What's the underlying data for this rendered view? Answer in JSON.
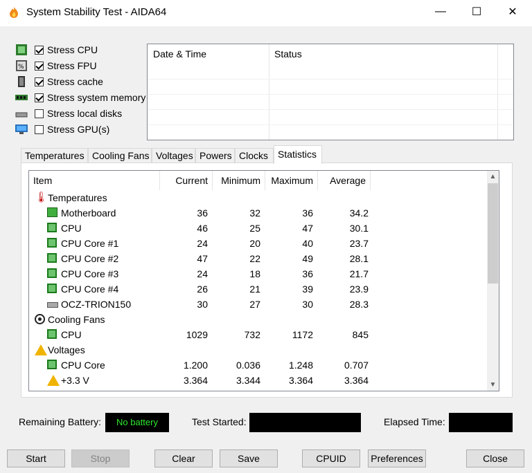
{
  "window": {
    "title": "System Stability Test - AIDA64",
    "minimize": "—",
    "maximize": "☐",
    "close": "✕"
  },
  "stress": [
    {
      "label": "Stress CPU",
      "checked": true,
      "icon": "cpu-icon"
    },
    {
      "label": "Stress FPU",
      "checked": true,
      "icon": "fpu-icon"
    },
    {
      "label": "Stress cache",
      "checked": true,
      "icon": "cache-icon"
    },
    {
      "label": "Stress system memory",
      "checked": true,
      "icon": "memory-icon"
    },
    {
      "label": "Stress local disks",
      "checked": false,
      "icon": "disk-icon"
    },
    {
      "label": "Stress GPU(s)",
      "checked": false,
      "icon": "gpu-icon"
    }
  ],
  "log": {
    "col_datetime": "Date & Time",
    "col_status": "Status"
  },
  "tabs": [
    "Temperatures",
    "Cooling Fans",
    "Voltages",
    "Powers",
    "Clocks",
    "Statistics"
  ],
  "active_tab": "Statistics",
  "stats": {
    "headers": {
      "item": "Item",
      "current": "Current",
      "minimum": "Minimum",
      "maximum": "Maximum",
      "average": "Average"
    },
    "groups": {
      "temperatures": "Temperatures",
      "fans": "Cooling Fans",
      "voltages": "Voltages"
    },
    "rows": [
      {
        "name": "Motherboard",
        "current": "36",
        "min": "32",
        "max": "36",
        "avg": "34.2"
      },
      {
        "name": "CPU",
        "current": "46",
        "min": "25",
        "max": "47",
        "avg": "30.1"
      },
      {
        "name": "CPU Core #1",
        "current": "24",
        "min": "20",
        "max": "40",
        "avg": "23.7"
      },
      {
        "name": "CPU Core #2",
        "current": "47",
        "min": "22",
        "max": "49",
        "avg": "28.1"
      },
      {
        "name": "CPU Core #3",
        "current": "24",
        "min": "18",
        "max": "36",
        "avg": "21.7"
      },
      {
        "name": "CPU Core #4",
        "current": "26",
        "min": "21",
        "max": "39",
        "avg": "23.9"
      },
      {
        "name": "OCZ-TRION150",
        "current": "30",
        "min": "27",
        "max": "30",
        "avg": "28.3"
      },
      {
        "name": "CPU",
        "current": "1029",
        "min": "732",
        "max": "1172",
        "avg": "845"
      },
      {
        "name": "CPU Core",
        "current": "1.200",
        "min": "0.036",
        "max": "1.248",
        "avg": "0.707"
      },
      {
        "name": "+3.3 V",
        "current": "3.364",
        "min": "3.344",
        "max": "3.364",
        "avg": "3.364"
      }
    ]
  },
  "status": {
    "battery_label": "Remaining Battery:",
    "battery_value": "No battery",
    "started_label": "Test Started:",
    "elapsed_label": "Elapsed Time:"
  },
  "buttons": {
    "start": "Start",
    "stop": "Stop",
    "clear": "Clear",
    "save": "Save",
    "cpuid": "CPUID",
    "preferences": "Preferences",
    "close": "Close"
  }
}
